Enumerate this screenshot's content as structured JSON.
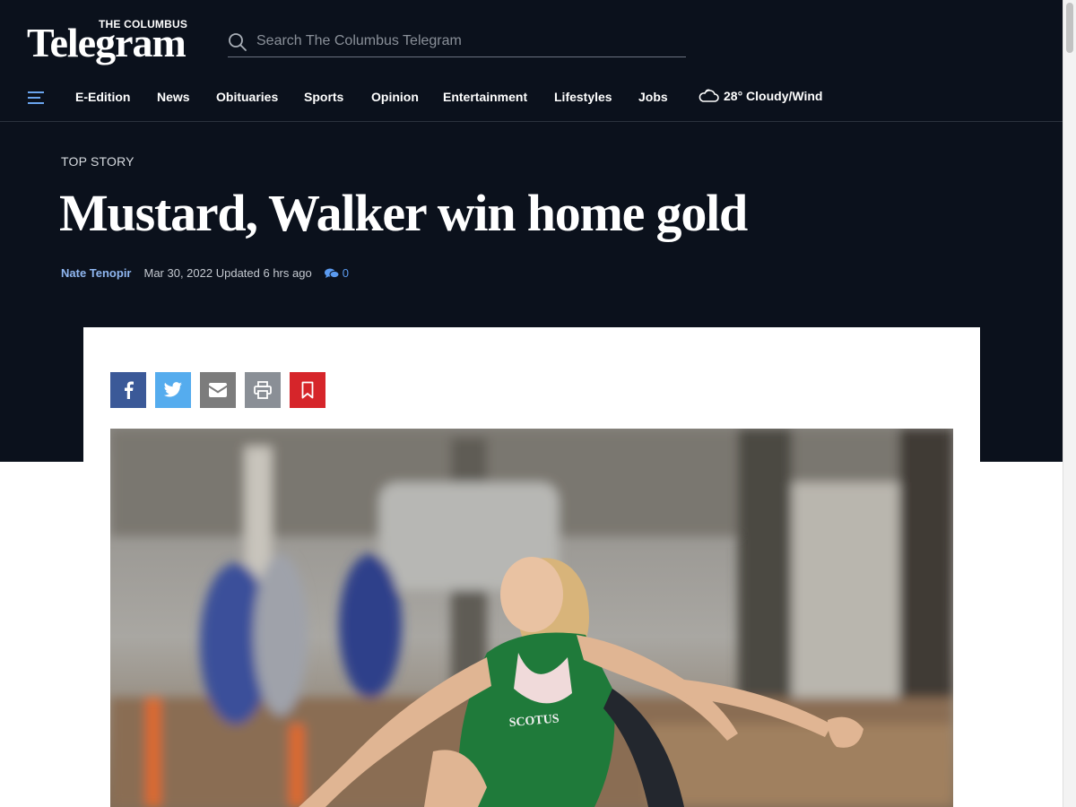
{
  "site": {
    "logo_small": "THE COLUMBUS",
    "logo_big": "Telegram"
  },
  "search": {
    "placeholder": "Search The Columbus Telegram",
    "icon": "search-icon"
  },
  "nav": {
    "menu_icon": "hamburger-icon",
    "items": [
      "E-Edition",
      "News",
      "Obituaries",
      "Sports",
      "Opinion",
      "Entertainment",
      "Lifestyles",
      "Jobs"
    ],
    "weather": "28° Cloudy/Wind",
    "weather_icon": "cloud-wind-icon"
  },
  "article": {
    "kicker": "TOP STORY",
    "headline": "Mustard, Walker win home gold",
    "author": "Nate Tenopir",
    "date": "Mar 30, 2022 Updated 6 hrs ago",
    "comment_count": "0"
  },
  "share_buttons": [
    "facebook-icon",
    "twitter-icon",
    "email-icon",
    "print-icon",
    "bookmark-icon"
  ],
  "colors": {
    "header_bg": "#0b111c",
    "facebook": "#3b5998",
    "twitter": "#55acee",
    "email": "#7c7c7c",
    "print": "#8a8f96",
    "bookmark": "#d6252a",
    "author_link": "#8fb6f0"
  }
}
